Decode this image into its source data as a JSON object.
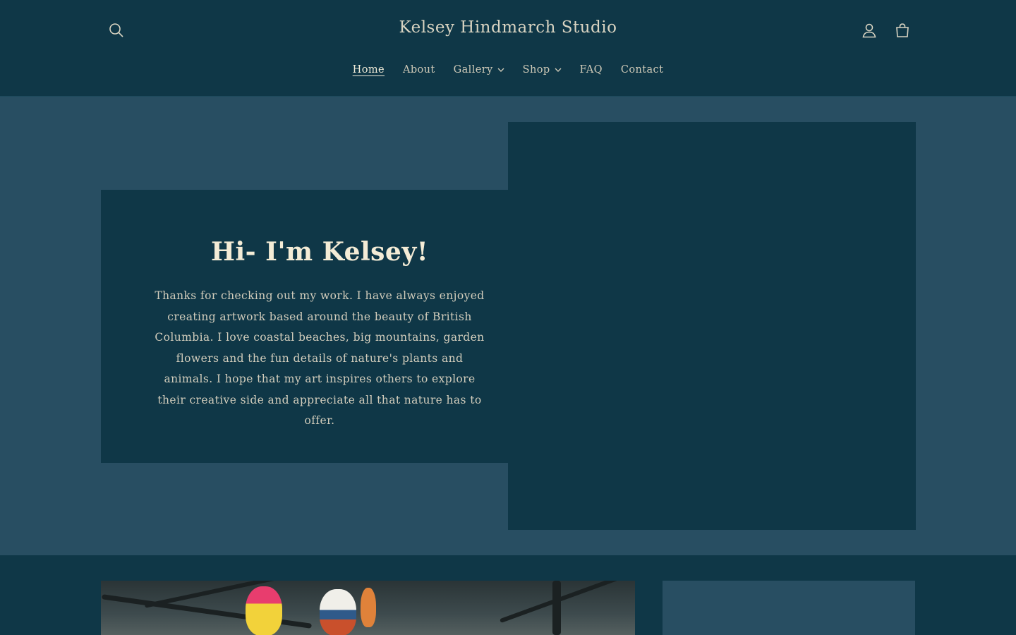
{
  "header": {
    "site_title": "Kelsey Hindmarch Studio",
    "icons": {
      "search": "search-icon",
      "account": "user-icon",
      "cart": "shopping-bag-icon"
    }
  },
  "nav": {
    "items": [
      {
        "label": "Home",
        "active": true,
        "dropdown": false
      },
      {
        "label": "About",
        "active": false,
        "dropdown": false
      },
      {
        "label": "Gallery",
        "active": false,
        "dropdown": true
      },
      {
        "label": "Shop",
        "active": false,
        "dropdown": true
      },
      {
        "label": "FAQ",
        "active": false,
        "dropdown": false
      },
      {
        "label": "Contact",
        "active": false,
        "dropdown": false
      }
    ]
  },
  "hero": {
    "heading": "Hi- I'm Kelsey!",
    "body": "Thanks for checking out my work. I have always enjoyed creating artwork based around the beauty of British Columbia. I love coastal beaches, big mountains, garden flowers and the fun details of nature's plants and animals. I hope that my art inspires others to explore their creative side and appreciate all that nature has to offer."
  },
  "colors": {
    "header_bg": "#0f3747",
    "band_bg": "#284e62",
    "text": "#d9d4c2",
    "heading": "#f4ecd6"
  }
}
